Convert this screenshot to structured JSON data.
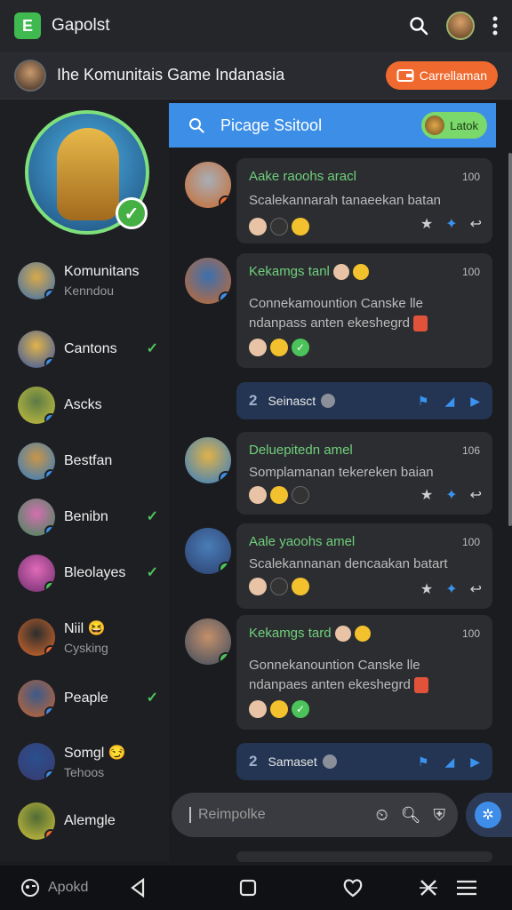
{
  "topbar": {
    "app_icon": "E",
    "title": "Gapolst",
    "search_icon": "search-icon",
    "more_icon": "more-vertical-icon"
  },
  "community": {
    "title": "Ihe Komunitais Game Indanasia",
    "button_label": "Carrellaman",
    "button_icon": "wallet-icon",
    "accent": "#f0692e"
  },
  "profile": {
    "verified": true,
    "ring_color": "#7ee07a"
  },
  "sidebar": {
    "items": [
      {
        "name": "Komunitans",
        "sub": "Kenndou",
        "checked": false
      },
      {
        "name": "Cantons",
        "sub": "",
        "checked": true
      },
      {
        "name": "Ascks",
        "sub": "",
        "checked": false
      },
      {
        "name": "Bestfan",
        "sub": "",
        "checked": false
      },
      {
        "name": "Benibn",
        "sub": "",
        "checked": true
      },
      {
        "name": "Bleolayes",
        "sub": "",
        "checked": true
      },
      {
        "name": "Niil",
        "sub": "Cysking",
        "checked": false,
        "emoji": "😆"
      },
      {
        "name": "Peaple",
        "sub": "",
        "checked": true
      },
      {
        "name": "Somgl",
        "sub": "Tehoos",
        "checked": false,
        "emoji": "😏"
      },
      {
        "name": "Alemgle",
        "sub": "",
        "checked": false
      }
    ]
  },
  "search": {
    "placeholder": "Picage Ssitool",
    "pill_label": "Latok",
    "accent": "#3d8ee6"
  },
  "messages": [
    {
      "title": "Aake raoohs aracl",
      "count": "100",
      "body": "Scalekannarah tanaeekan batan"
    },
    {
      "title": "Kekamgs tanl",
      "count": "100",
      "body": "Connekamountion Canske lle ndanpass anten ekeshegrd"
    },
    {
      "title": "Deluepitedn amel",
      "count": "106",
      "body": "Somplamanan tekereken baian"
    },
    {
      "title": "Aale yaoohs amel",
      "count": "100",
      "body": "Scalekannanan dencaakan batart"
    },
    {
      "title": "Kekamgs tard",
      "count": "100",
      "body": "Gonnekanountion Canske lle ndanpaes anten ekeshegrd"
    }
  ],
  "sections": [
    {
      "number": "2",
      "label": "Seinasct"
    },
    {
      "number": "2",
      "label": "Samaset"
    }
  ],
  "composer": {
    "placeholder": "Reimpolke"
  },
  "navbar": {
    "app_label": "Apokd"
  },
  "colors": {
    "green": "#6fd07b",
    "check": "#4cc35a",
    "section": "#233552"
  }
}
